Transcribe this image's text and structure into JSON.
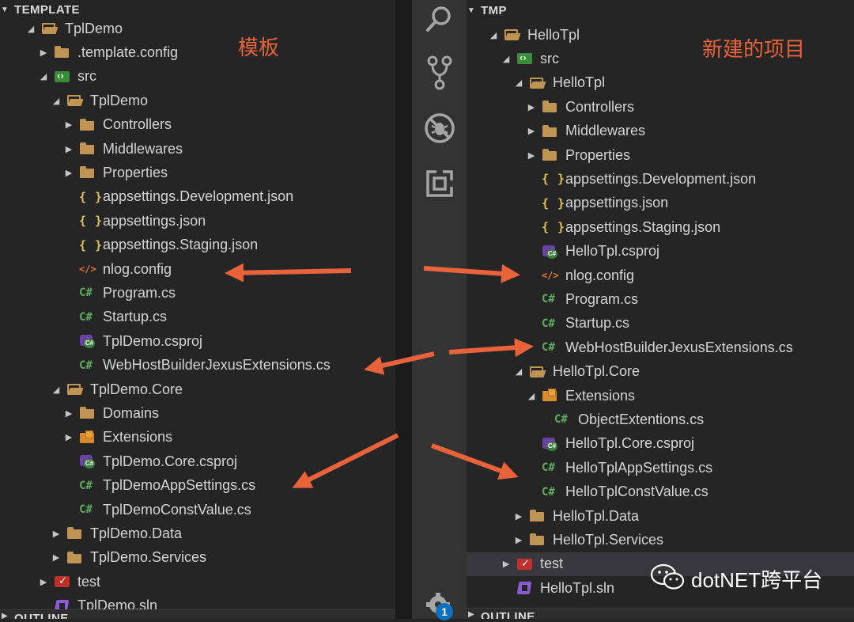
{
  "left_explorer": {
    "section_title": "TEMPLATE",
    "annotation": "模板",
    "items": [
      {
        "label": "TplDemo",
        "indent": 2,
        "twisty": "open",
        "icon": "folder-open-icon"
      },
      {
        "label": ".template.config",
        "indent": 3,
        "twisty": "closed",
        "icon": "folder-icon"
      },
      {
        "label": "src",
        "indent": 3,
        "twisty": "open",
        "icon": "folder-src-icon"
      },
      {
        "label": "TplDemo",
        "indent": 4,
        "twisty": "open",
        "icon": "folder-open-icon"
      },
      {
        "label": "Controllers",
        "indent": 5,
        "twisty": "closed",
        "icon": "folder-icon"
      },
      {
        "label": "Middlewares",
        "indent": 5,
        "twisty": "closed",
        "icon": "folder-icon"
      },
      {
        "label": "Properties",
        "indent": 5,
        "twisty": "closed",
        "icon": "folder-icon"
      },
      {
        "label": "appsettings.Development.json",
        "indent": 5,
        "twisty": "none",
        "icon": "json-icon"
      },
      {
        "label": "appsettings.json",
        "indent": 5,
        "twisty": "none",
        "icon": "json-icon"
      },
      {
        "label": "appsettings.Staging.json",
        "indent": 5,
        "twisty": "none",
        "icon": "json-icon"
      },
      {
        "label": "nlog.config",
        "indent": 5,
        "twisty": "none",
        "icon": "xml-icon"
      },
      {
        "label": "Program.cs",
        "indent": 5,
        "twisty": "none",
        "icon": "csharp-icon"
      },
      {
        "label": "Startup.cs",
        "indent": 5,
        "twisty": "none",
        "icon": "csharp-icon"
      },
      {
        "label": "TplDemo.csproj",
        "indent": 5,
        "twisty": "none",
        "icon": "csproj-icon"
      },
      {
        "label": "WebHostBuilderJexusExtensions.cs",
        "indent": 5,
        "twisty": "none",
        "icon": "csharp-icon"
      },
      {
        "label": "TplDemo.Core",
        "indent": 4,
        "twisty": "open",
        "icon": "folder-open-icon"
      },
      {
        "label": "Domains",
        "indent": 5,
        "twisty": "closed",
        "icon": "folder-icon"
      },
      {
        "label": "Extensions",
        "indent": 5,
        "twisty": "closed",
        "icon": "folder-extensions-icon"
      },
      {
        "label": "TplDemo.Core.csproj",
        "indent": 5,
        "twisty": "none",
        "icon": "csproj-icon"
      },
      {
        "label": "TplDemoAppSettings.cs",
        "indent": 5,
        "twisty": "none",
        "icon": "csharp-icon"
      },
      {
        "label": "TplDemoConstValue.cs",
        "indent": 5,
        "twisty": "none",
        "icon": "csharp-icon"
      },
      {
        "label": "TplDemo.Data",
        "indent": 4,
        "twisty": "closed",
        "icon": "folder-icon"
      },
      {
        "label": "TplDemo.Services",
        "indent": 4,
        "twisty": "closed",
        "icon": "folder-icon"
      },
      {
        "label": "test",
        "indent": 3,
        "twisty": "closed",
        "icon": "folder-test-icon"
      },
      {
        "label": "TplDemo.sln",
        "indent": 3,
        "twisty": "none",
        "icon": "sln-icon"
      }
    ],
    "outline_title": "OUTLINE"
  },
  "right_explorer": {
    "section_title": "TMP",
    "annotation": "新建的项目",
    "items": [
      {
        "label": "HelloTpl",
        "indent": 1,
        "twisty": "open",
        "icon": "folder-open-icon"
      },
      {
        "label": "src",
        "indent": 2,
        "twisty": "open",
        "icon": "folder-src-icon"
      },
      {
        "label": "HelloTpl",
        "indent": 3,
        "twisty": "open",
        "icon": "folder-open-icon"
      },
      {
        "label": "Controllers",
        "indent": 4,
        "twisty": "closed",
        "icon": "folder-icon"
      },
      {
        "label": "Middlewares",
        "indent": 4,
        "twisty": "closed",
        "icon": "folder-icon"
      },
      {
        "label": "Properties",
        "indent": 4,
        "twisty": "closed",
        "icon": "folder-icon"
      },
      {
        "label": "appsettings.Development.json",
        "indent": 4,
        "twisty": "none",
        "icon": "json-icon"
      },
      {
        "label": "appsettings.json",
        "indent": 4,
        "twisty": "none",
        "icon": "json-icon"
      },
      {
        "label": "appsettings.Staging.json",
        "indent": 4,
        "twisty": "none",
        "icon": "json-icon"
      },
      {
        "label": "HelloTpl.csproj",
        "indent": 4,
        "twisty": "none",
        "icon": "csproj-icon"
      },
      {
        "label": "nlog.config",
        "indent": 4,
        "twisty": "none",
        "icon": "xml-icon"
      },
      {
        "label": "Program.cs",
        "indent": 4,
        "twisty": "none",
        "icon": "csharp-icon"
      },
      {
        "label": "Startup.cs",
        "indent": 4,
        "twisty": "none",
        "icon": "csharp-icon"
      },
      {
        "label": "WebHostBuilderJexusExtensions.cs",
        "indent": 4,
        "twisty": "none",
        "icon": "csharp-icon"
      },
      {
        "label": "HelloTpl.Core",
        "indent": 3,
        "twisty": "open",
        "icon": "folder-open-icon"
      },
      {
        "label": "Extensions",
        "indent": 4,
        "twisty": "open",
        "icon": "folder-extensions-icon"
      },
      {
        "label": "ObjectExtentions.cs",
        "indent": 5,
        "twisty": "none",
        "icon": "csharp-icon"
      },
      {
        "label": "HelloTpl.Core.csproj",
        "indent": 4,
        "twisty": "none",
        "icon": "csproj-icon"
      },
      {
        "label": "HelloTplAppSettings.cs",
        "indent": 4,
        "twisty": "none",
        "icon": "csharp-icon"
      },
      {
        "label": "HelloTplConstValue.cs",
        "indent": 4,
        "twisty": "none",
        "icon": "csharp-icon"
      },
      {
        "label": "HelloTpl.Data",
        "indent": 3,
        "twisty": "closed",
        "icon": "folder-icon"
      },
      {
        "label": "HelloTpl.Services",
        "indent": 3,
        "twisty": "closed",
        "icon": "folder-icon"
      },
      {
        "label": "test",
        "indent": 2,
        "twisty": "closed",
        "icon": "folder-test-icon",
        "selected": true
      },
      {
        "label": "HelloTpl.sln",
        "indent": 2,
        "twisty": "none",
        "icon": "sln-icon"
      }
    ],
    "outline_title": "OUTLINE"
  },
  "activity_bar": {
    "icons": [
      "search-icon",
      "source-control-icon",
      "debug-icon",
      "extensions-icon",
      "settings-gear-icon"
    ],
    "settings_badge": "1"
  },
  "watermark": {
    "text": "dotNET跨平台",
    "icon": "wechat-icon"
  },
  "colors": {
    "annotation": "#e8623a",
    "arrow": "#e8623a",
    "sidebar_bg": "#252526",
    "activity_bg": "#333333",
    "folder": "#c09553"
  }
}
